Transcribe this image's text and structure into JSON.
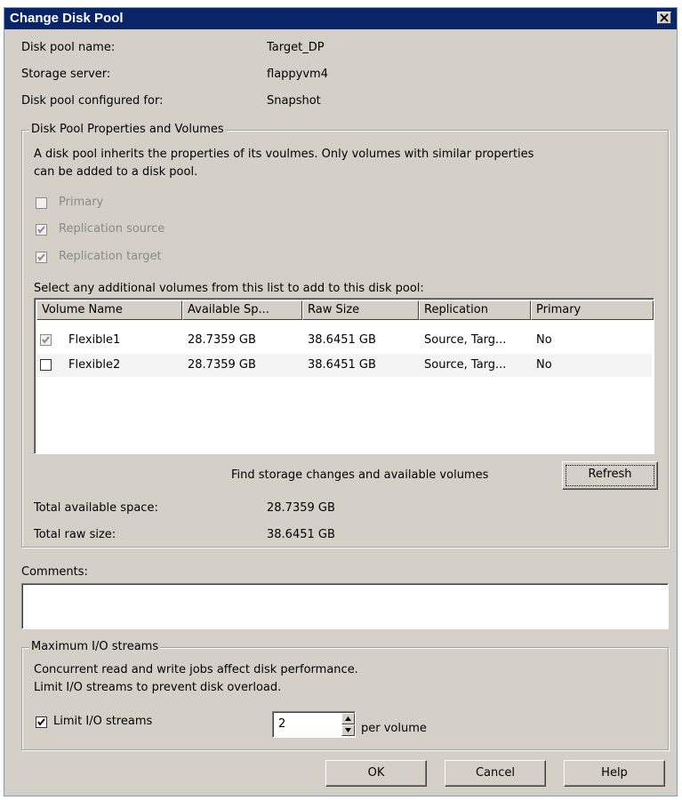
{
  "window": {
    "title": "Change Disk Pool"
  },
  "info": {
    "pool_name_label": "Disk pool name:",
    "pool_name_value": "Target_DP",
    "server_label": "Storage server:",
    "server_value": "flappyvm4",
    "configured_label": "Disk pool configured for:",
    "configured_value": "Snapshot"
  },
  "properties": {
    "legend": "Disk Pool Properties and Volumes",
    "description_line1": "A disk pool inherits the properties of its voulmes. Only volumes with similar properties",
    "description_line2": "can be added to a disk pool.",
    "primary_label": "Primary",
    "repl_source_label": "Replication source",
    "repl_target_label": "Replication target",
    "select_label": "Select any additional volumes from this list to add to this disk pool:",
    "columns": [
      "Volume Name",
      "Available Sp...",
      "Raw Size",
      "Replication",
      "Primary"
    ],
    "rows": [
      {
        "name": "Flexible1",
        "available": "28.7359 GB",
        "raw": "38.6451 GB",
        "replication": "Source, Targ...",
        "primary": "No",
        "checked": true
      },
      {
        "name": "Flexible2",
        "available": "28.7359 GB",
        "raw": "38.6451 GB",
        "replication": "Source, Targ...",
        "primary": "No",
        "checked": false
      }
    ],
    "find_label": "Find storage changes and available volumes",
    "refresh_label": "Refresh",
    "total_available_label": "Total available space:",
    "total_available_value": "28.7359 GB",
    "total_raw_label": "Total raw size:",
    "total_raw_value": "38.6451 GB"
  },
  "comments": {
    "label": "Comments:",
    "value": ""
  },
  "io": {
    "legend": "Maximum I/O streams",
    "line1": "Concurrent read and write jobs affect disk performance.",
    "line2": "Limit I/O streams to prevent disk overload.",
    "limit_label": "Limit I/O streams",
    "limit_checked": true,
    "streams_value": "2",
    "per_volume_label": "per volume"
  },
  "buttons": {
    "ok": "OK",
    "cancel": "Cancel",
    "help": "Help"
  }
}
